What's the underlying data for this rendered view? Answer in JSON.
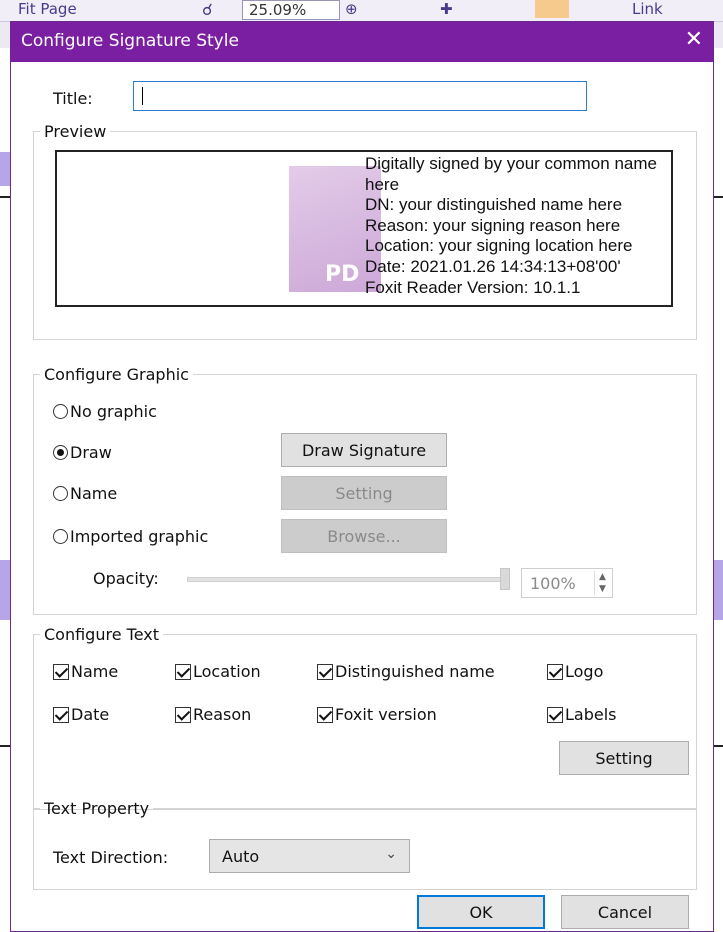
{
  "background": {
    "fit_page_label": "Fit Page",
    "zoom_value": "25.09%",
    "link_label": "Link"
  },
  "dialog": {
    "title": "Configure Signature Style",
    "close_icon": "close-icon",
    "title_label": "Title:",
    "title_value": "",
    "preview": {
      "legend": "Preview",
      "watermark_text": "PD",
      "lines": [
        "Digitally signed by your common name here",
        "DN: your distinguished name here",
        "Reason: your signing reason here",
        "Location: your signing location here",
        "Date: 2021.01.26 14:34:13+08'00'",
        "Foxit Reader Version: 10.1.1"
      ]
    },
    "graphic": {
      "legend": "Configure Graphic",
      "options": [
        "No graphic",
        "Draw",
        "Name",
        "Imported graphic"
      ],
      "selected": "Draw",
      "draw_button": "Draw Signature",
      "setting_button": "Setting",
      "browse_button": "Browse...",
      "opacity_label": "Opacity:",
      "opacity_value": "100%",
      "opacity_fraction": 1.0
    },
    "text": {
      "legend": "Configure Text",
      "items": [
        {
          "label": "Name",
          "checked": true
        },
        {
          "label": "Location",
          "checked": true
        },
        {
          "label": "Distinguished name",
          "checked": true
        },
        {
          "label": "Logo",
          "checked": true
        },
        {
          "label": "Date",
          "checked": true
        },
        {
          "label": "Reason",
          "checked": true
        },
        {
          "label": "Foxit version",
          "checked": true
        },
        {
          "label": "Labels",
          "checked": true
        }
      ],
      "setting_button": "Setting"
    },
    "property": {
      "legend": "Text Property",
      "direction_label": "Text Direction:",
      "direction_value": "Auto"
    },
    "ok_button": "OK",
    "cancel_button": "Cancel"
  },
  "colors": {
    "titlebar": "#7b1fa2",
    "input_border": "#2b7bd1",
    "ok_border": "#0078d7"
  }
}
